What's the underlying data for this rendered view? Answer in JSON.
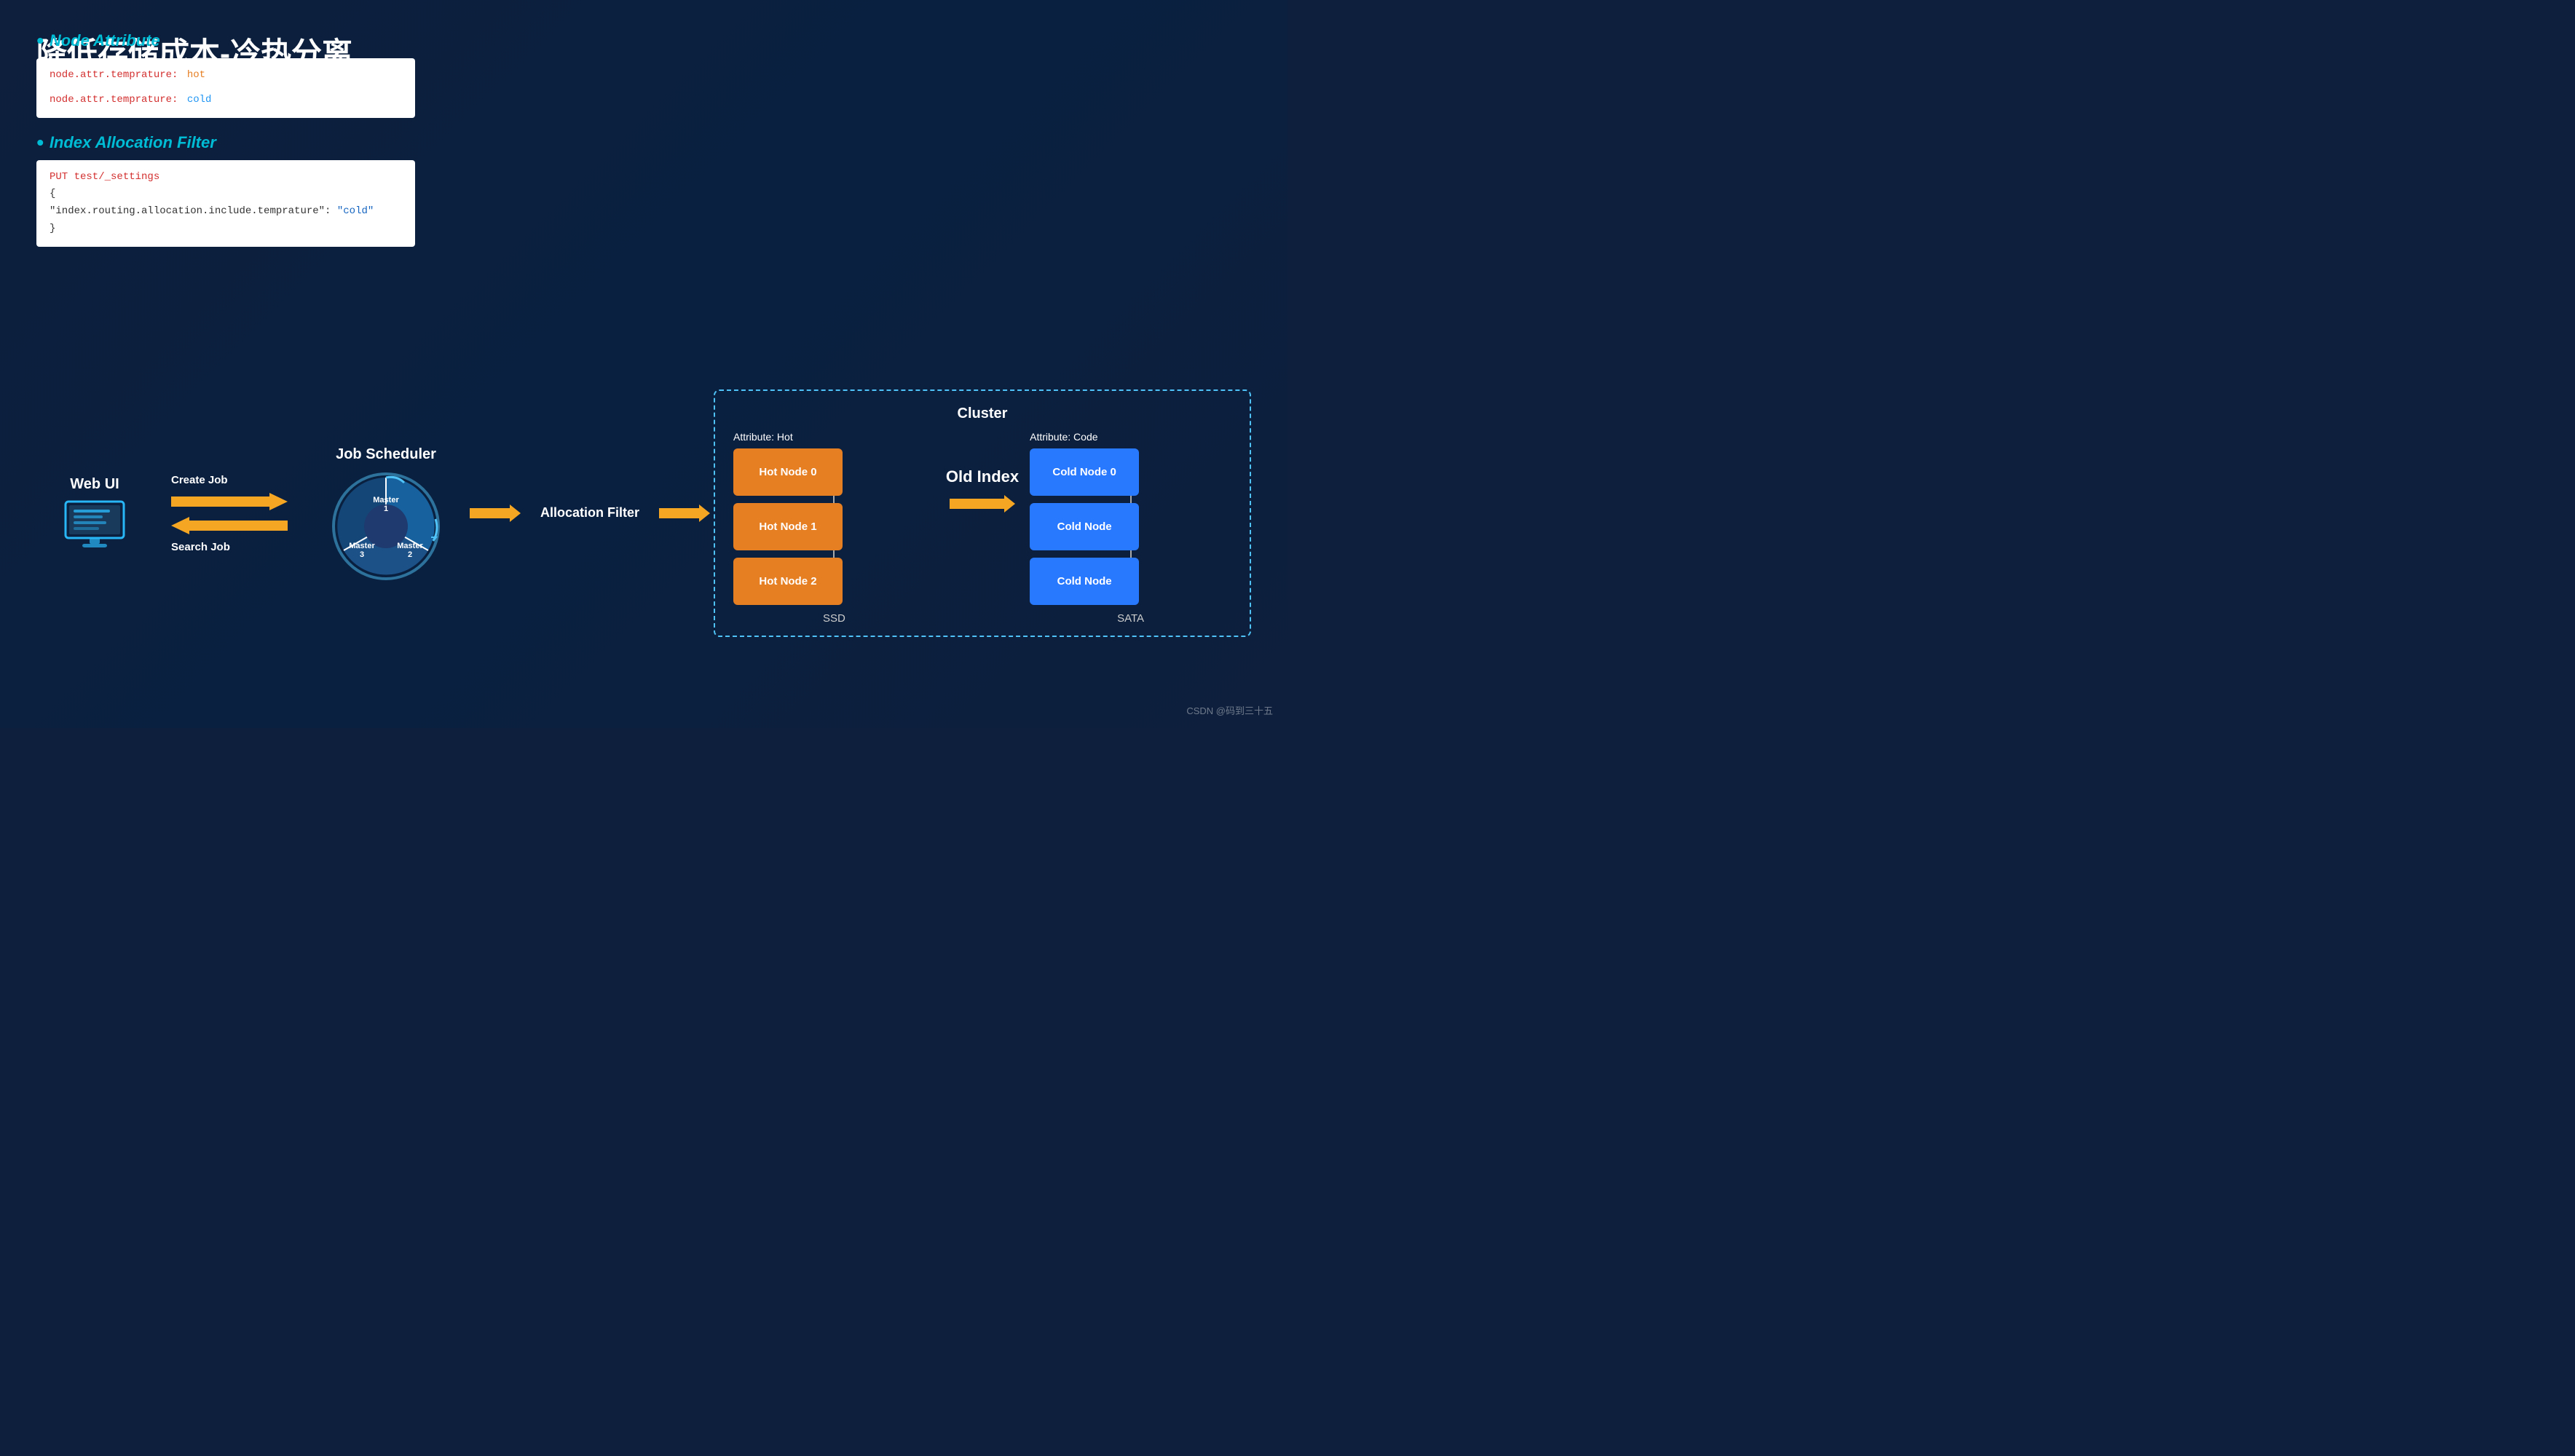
{
  "title": "降低存储成本-冷热分离",
  "node_attribute_label": "Node Attribute",
  "code1_line1_prefix": "node.attr.temprature:",
  "code1_line1_value": "hot",
  "code1_line2_prefix": "node.attr.temprature:",
  "code1_line2_value": "cold",
  "index_filter_label": "Index Allocation Filter",
  "code2_line1": "PUT test/_settings",
  "code2_line2": "{",
  "code2_line3_key": "\"index.routing.allocation.include.temprature\":",
  "code2_line3_val": "\"cold\"",
  "code2_line4": "}",
  "web_ui_label": "Web UI",
  "create_job_label": "Create Job",
  "search_job_label": "Search Job",
  "job_scheduler_label": "Job Scheduler",
  "master1_label": "Master 1",
  "master2_label": "Master 2",
  "master3_label": "Master 3",
  "allocation_filter_label": "Allocation Filter",
  "cluster_title": "Cluster",
  "attribute_hot_label": "Attribute: Hot",
  "attribute_cold_label": "Attribute: Code",
  "hot_node0": "Hot Node 0",
  "hot_node1": "Hot Node 1",
  "hot_node2": "Hot Node 2",
  "cold_node0": "Cold Node 0",
  "cold_node1": "Cold Node",
  "cold_node2": "Cold Node",
  "old_index_label": "Old Index",
  "ssd_label": "SSD",
  "sata_label": "SATA",
  "watermark": "CSDN @码到三十五",
  "colors": {
    "bg": "#0d1f3c",
    "accent_cyan": "#00bcd4",
    "hot_orange": "#e67e22",
    "cold_blue": "#2979ff",
    "arrow_yellow": "#f5a623",
    "cluster_border": "#4fc3f7"
  }
}
